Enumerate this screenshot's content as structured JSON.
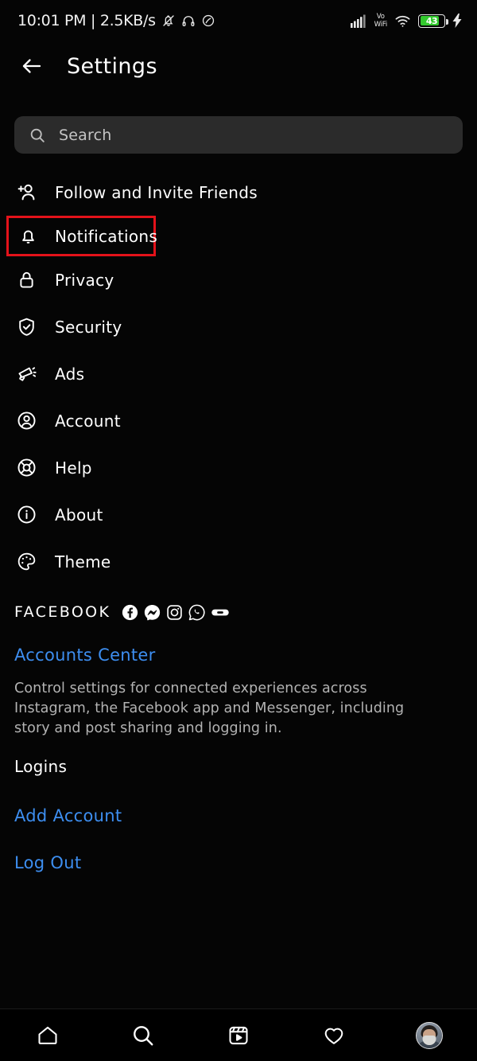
{
  "statusbar": {
    "time_and_rate": "10:01 PM | 2.5KB/s",
    "left_icons": [
      "bell-muted-icon",
      "headphones-icon",
      "dnd-icon"
    ],
    "network_label_top": "Vo",
    "network_label_bottom": "WiFi",
    "battery_level": "43",
    "battery_color": "#33c92e",
    "right_icons": [
      "signal-bars-icon",
      "vowifi-icon",
      "wifi-icon",
      "battery-icon",
      "charging-bolt-icon"
    ]
  },
  "header": {
    "back_icon": "arrow-left-icon",
    "title": "Settings"
  },
  "search": {
    "icon": "search-icon",
    "placeholder": "Search",
    "value": ""
  },
  "menu": {
    "items": [
      {
        "label": "Follow and Invite Friends",
        "icon": "person-add-icon",
        "highlighted": false
      },
      {
        "label": "Notifications",
        "icon": "bell-icon",
        "highlighted": true
      },
      {
        "label": "Privacy",
        "icon": "lock-icon",
        "highlighted": false
      },
      {
        "label": "Security",
        "icon": "shield-check-icon",
        "highlighted": false
      },
      {
        "label": "Ads",
        "icon": "megaphone-icon",
        "highlighted": false
      },
      {
        "label": "Account",
        "icon": "user-circle-icon",
        "highlighted": false
      },
      {
        "label": "Help",
        "icon": "lifebuoy-icon",
        "highlighted": false
      },
      {
        "label": "About",
        "icon": "info-circle-icon",
        "highlighted": false
      },
      {
        "label": "Theme",
        "icon": "palette-icon",
        "highlighted": false
      }
    ],
    "highlight_color": "#e4121a"
  },
  "facebook_section": {
    "title": "FACEBOOK",
    "app_icons": [
      "facebook-icon",
      "messenger-icon",
      "instagram-icon",
      "whatsapp-icon",
      "meta-oculus-icon"
    ],
    "accounts_center_link": "Accounts Center",
    "description": "Control settings for connected experiences across Instagram, the Facebook app and Messenger, including story and post sharing and logging in.",
    "logins_title": "Logins",
    "add_account_link": "Add Account",
    "log_out_link": "Log Out",
    "link_color": "#3d8ef0"
  },
  "bottomnav": {
    "items": [
      {
        "name": "home",
        "icon": "home-icon"
      },
      {
        "name": "search",
        "icon": "search-icon"
      },
      {
        "name": "reels",
        "icon": "reels-icon"
      },
      {
        "name": "activity",
        "icon": "heart-icon"
      },
      {
        "name": "profile",
        "icon": "avatar-icon"
      }
    ]
  }
}
